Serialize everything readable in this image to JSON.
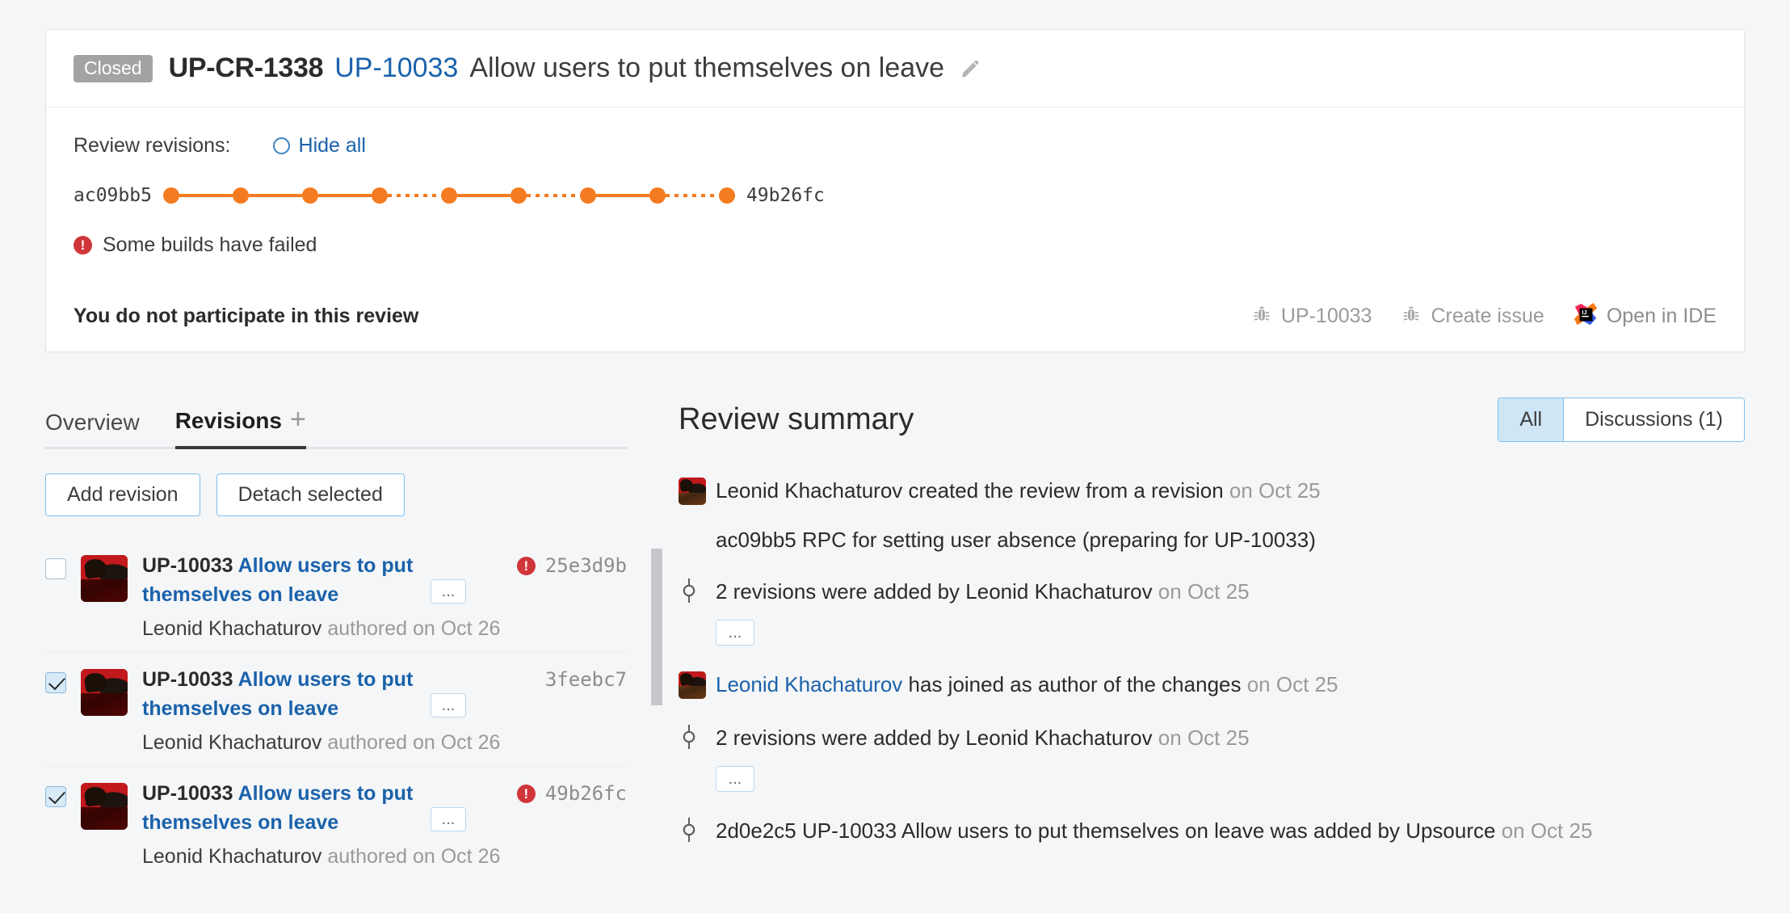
{
  "header": {
    "status_badge": "Closed",
    "review_id": "UP-CR-1338",
    "issue_id": "UP-10033",
    "summary": "Allow users to put themselves on leave",
    "edit_icon": "pencil-icon",
    "revisions_label": "Review revisions:",
    "hide_all_label": "Hide all",
    "first_hash": "ac09bb5",
    "last_hash": "49b26fc",
    "build_status": "Some builds have failed",
    "participation": "You do not participate in this review",
    "actions": [
      {
        "icon": "bug-icon",
        "label": "UP-10033"
      },
      {
        "icon": "bug-icon",
        "label": "Create issue"
      },
      {
        "icon": "intellij-idea-icon",
        "label": "Open in IDE"
      }
    ],
    "timeline": {
      "dots": 9,
      "segments": [
        "solid",
        "solid",
        "solid",
        "dotted",
        "solid",
        "dotted",
        "solid",
        "dotted"
      ],
      "dot_color": "#f47b20"
    }
  },
  "left": {
    "tabs": [
      {
        "label": "Overview",
        "active": false
      },
      {
        "label": "Revisions",
        "active": true
      }
    ],
    "tab_plus": "+",
    "buttons": {
      "add_revision": "Add revision",
      "detach_selected": "Detach selected"
    },
    "revisions": [
      {
        "checked": true,
        "prefix": "UP-10033 ",
        "title": "Allow users to put themselves on leave",
        "dots": "...",
        "has_error": true,
        "hash": "49b26fc",
        "author": "Leonid Khachaturov",
        "meta": " authored on Oct 26"
      },
      {
        "checked": true,
        "prefix": "UP-10033 ",
        "title": "Allow users to put themselves on leave",
        "dots": "...",
        "has_error": false,
        "hash": "3feebc7",
        "author": "Leonid Khachaturov",
        "meta": " authored on Oct 26"
      },
      {
        "checked": false,
        "prefix": "UP-10033 ",
        "title": "Allow users to put themselves on leave",
        "dots": "...",
        "has_error": true,
        "hash": "25e3d9b",
        "author": "Leonid Khachaturov",
        "meta": " authored on Oct 26"
      }
    ]
  },
  "right": {
    "title": "Review summary",
    "filters": [
      {
        "label": "All",
        "active": true
      },
      {
        "label": "Discussions (1)",
        "active": false
      }
    ],
    "feed": [
      {
        "icon": "user-avatar",
        "text": "Leonid Khachaturov created the review from a revision",
        "time": " on Oct 25",
        "detail": "ac09bb5 RPC for setting user absence (preparing for UP-10033)",
        "has_dots": false
      },
      {
        "icon": "revision-node-icon",
        "text": "2 revisions were added by Leonid Khachaturov",
        "time": " on Oct 25",
        "detail": "",
        "has_dots": true,
        "dots": "..."
      },
      {
        "icon": "user-avatar",
        "link_text": "Leonid Khachaturov",
        "text": " has joined as author of the changes",
        "time": " on Oct 25",
        "detail": "",
        "has_dots": false
      },
      {
        "icon": "revision-node-icon",
        "text": "2 revisions were added by Leonid Khachaturov",
        "time": " on Oct 25",
        "detail": "",
        "has_dots": true,
        "dots": "..."
      },
      {
        "icon": "revision-node-icon",
        "text": "2d0e2c5 UP-10033 Allow users to put themselves on leave was added by Upsource",
        "time": " on Oct 25",
        "detail": "",
        "has_dots": false
      }
    ]
  },
  "colors": {
    "accent_orange": "#f47b20",
    "link_blue": "#1a62ab",
    "error_red": "#d0353a",
    "page_bg": "#f5f6f7"
  }
}
